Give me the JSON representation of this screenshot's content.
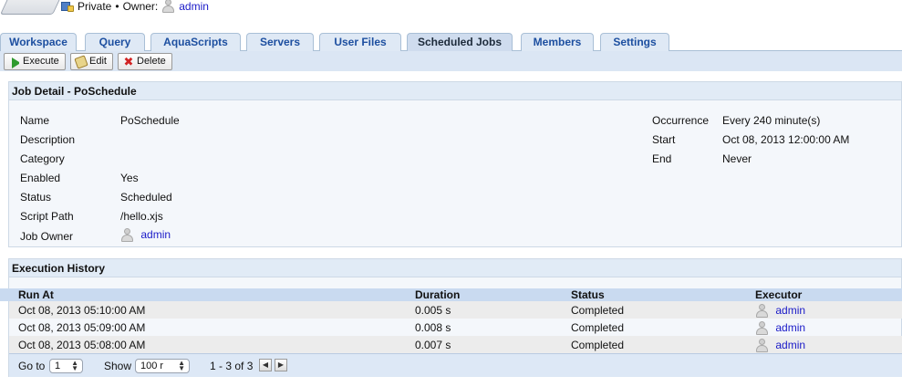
{
  "header": {
    "visibility": "Private",
    "bullet": "•",
    "owner_label": "Owner:",
    "owner_name": "admin"
  },
  "tabs": [
    {
      "label": "Workspace",
      "active": false
    },
    {
      "label": "Query",
      "active": false
    },
    {
      "label": "AquaScripts",
      "active": false
    },
    {
      "label": "Servers",
      "active": false
    },
    {
      "label": "User Files",
      "active": false
    },
    {
      "label": "Scheduled Jobs",
      "active": true
    },
    {
      "label": "Members",
      "active": false
    },
    {
      "label": "Settings",
      "active": false
    }
  ],
  "toolbar": {
    "execute": "Execute",
    "edit": "Edit",
    "delete": "Delete"
  },
  "job_detail": {
    "title": "Job Detail - PoSchedule",
    "left": [
      {
        "label": "Name",
        "value": "PoSchedule"
      },
      {
        "label": "Description",
        "value": ""
      },
      {
        "label": "Category",
        "value": ""
      },
      {
        "label": "Enabled",
        "value": "Yes"
      },
      {
        "label": "Status",
        "value": "Scheduled"
      },
      {
        "label": "Script Path",
        "value": "/hello.xjs"
      },
      {
        "label": "Job Owner",
        "value": "admin"
      }
    ],
    "right": [
      {
        "label": "Occurrence",
        "value": "Every 240 minute(s)"
      },
      {
        "label": "Start",
        "value": "Oct 08, 2013 12:00:00 AM"
      },
      {
        "label": "End",
        "value": "Never"
      }
    ]
  },
  "history": {
    "title": "Execution History",
    "columns": [
      "Run At",
      "Duration",
      "Status",
      "Executor"
    ],
    "rows": [
      {
        "run_at": "Oct 08, 2013 05:10:00 AM",
        "duration": "0.005 s",
        "status": "Completed",
        "executor": "admin"
      },
      {
        "run_at": "Oct 08, 2013 05:09:00 AM",
        "duration": "0.008 s",
        "status": "Completed",
        "executor": "admin"
      },
      {
        "run_at": "Oct 08, 2013 05:08:00 AM",
        "duration": "0.007 s",
        "status": "Completed",
        "executor": "admin"
      }
    ],
    "footer": {
      "goto_label": "Go to",
      "goto_value": "1",
      "show_label": "Show",
      "show_value": "100 r",
      "range": "1 - 3 of 3"
    }
  },
  "colors": {
    "accent": "#1d4fa0",
    "tab_bg": "#dfe9f5",
    "toolbar_bg": "#dbe6f4",
    "link": "#1a1ac8"
  }
}
